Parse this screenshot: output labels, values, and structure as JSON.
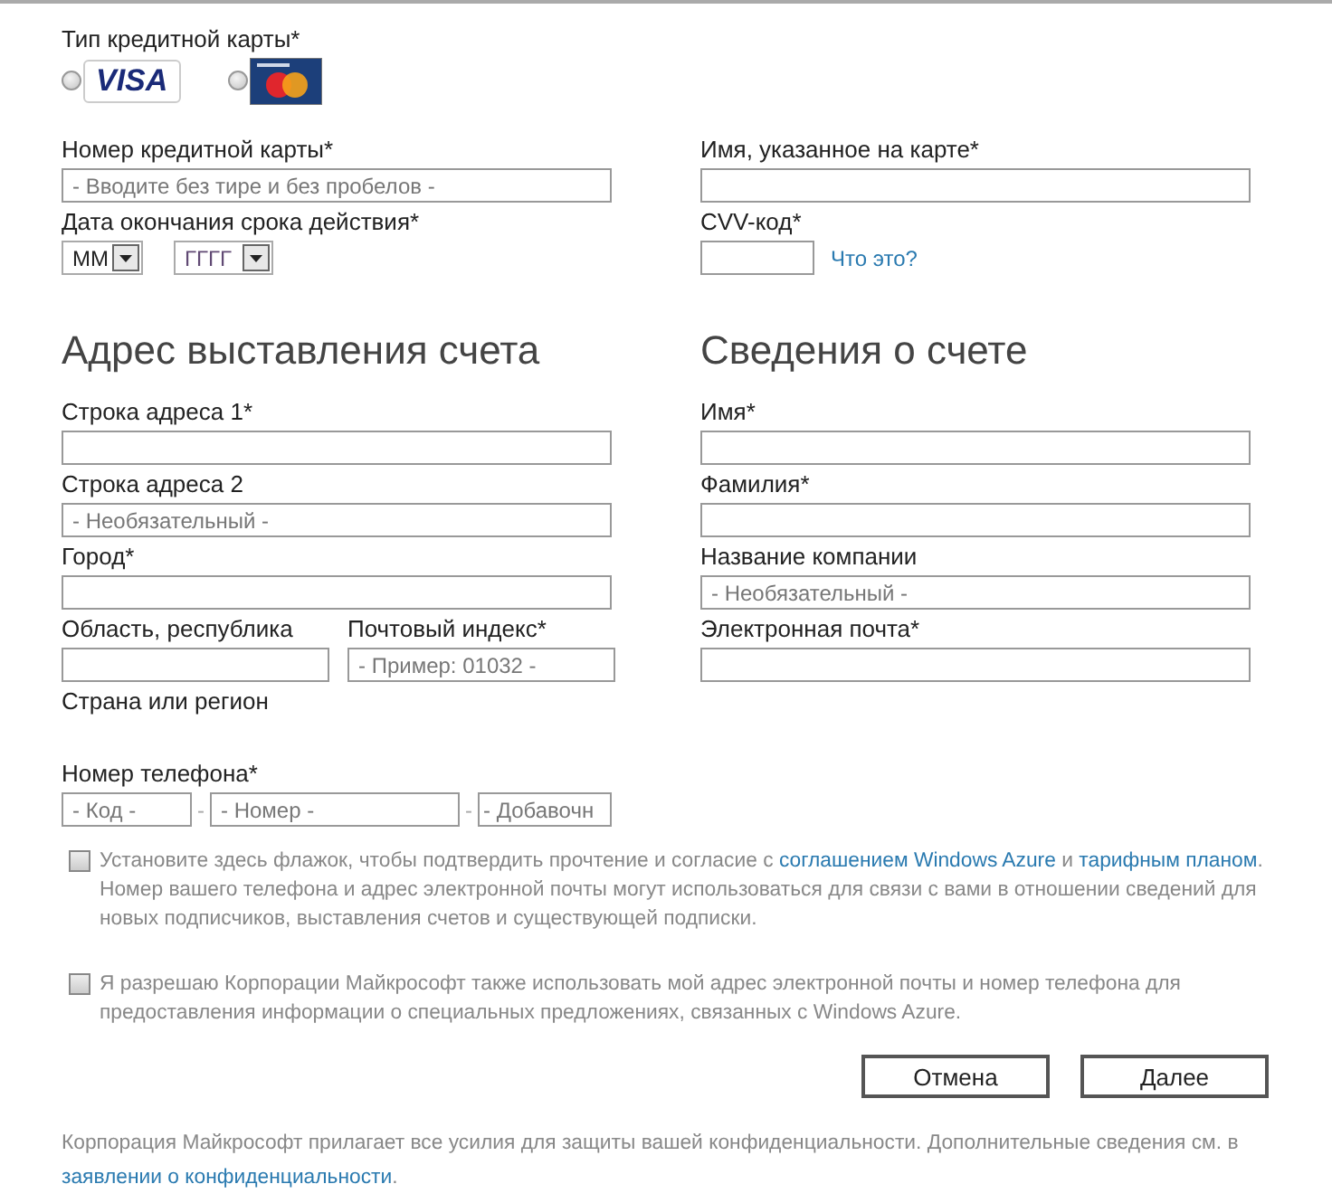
{
  "card_type": {
    "label": "Тип кредитной карты*",
    "options": [
      {
        "kind": "visa",
        "logo_text": "VISA",
        "selected": false
      },
      {
        "kind": "mastercard",
        "selected": false
      }
    ]
  },
  "card_number": {
    "label": "Номер кредитной карты*",
    "placeholder": "- Вводите без тире и без пробелов -"
  },
  "expiry": {
    "label": "Дата окончания срока действия*",
    "month": "ММ",
    "year": "ГГГГ"
  },
  "name_on_card": {
    "label": "Имя, указанное на карте*"
  },
  "cvv": {
    "label": "CVV-код*",
    "help_link": "Что это?"
  },
  "billing_address": {
    "title": "Адрес выставления счета",
    "fields": [
      {
        "label": "Строка адреса 1*"
      },
      {
        "label": "Строка адреса 2",
        "placeholder": "- Необязательный -"
      },
      {
        "label": "Город*"
      }
    ],
    "region": {
      "label": "Область, республика"
    },
    "postal_code": {
      "label": "Почтовый индекс*",
      "placeholder": "- Пример: 01032 -"
    },
    "country": {
      "label": "Страна или регион"
    },
    "phone": {
      "label": "Номер телефона*",
      "separator": "-",
      "parts": [
        {
          "placeholder": "- Код -"
        },
        {
          "placeholder": "- Номер -"
        },
        {
          "placeholder": "- Добавочн"
        }
      ]
    }
  },
  "account_info": {
    "title": "Сведения о счете",
    "fields": [
      {
        "label": "Имя*"
      },
      {
        "label": "Фамилия*"
      },
      {
        "label": "Название компании",
        "placeholder": "- Необязательный -"
      },
      {
        "label": "Электронная почта*"
      }
    ]
  },
  "consents": [
    {
      "checked": false,
      "segments": [
        {
          "text": "Установите здесь флажок, чтобы подтвердить прочтение и согласие с ",
          "link": false
        },
        {
          "text": "соглашением Windows Azure",
          "link": true
        },
        {
          "text": " и ",
          "link": false
        },
        {
          "text": "тарифным планом",
          "link": true
        },
        {
          "text": ". Номер вашего телефона и адрес электронной почты могут использоваться для связи с вами в отношении сведений для новых подписчиков, выставления счетов и существующей подписки.",
          "link": false
        }
      ]
    },
    {
      "checked": false,
      "segments": [
        {
          "text": "Я разрешаю Корпорации Майкрософт также использовать мой адрес электронной почты и номер телефона для предоставления информации о специальных предложениях, связанных с Windows Azure.",
          "link": false
        }
      ]
    }
  ],
  "buttons": [
    "Отмена",
    "Далее"
  ],
  "privacy": {
    "segments": [
      {
        "text": "Корпорация Майкрософт прилагает все усилия для защиты вашей конфиденциальности. Дополнительные сведения см. в ",
        "link": false
      },
      {
        "text": "заявлении о конфиденциальности",
        "link": true
      },
      {
        "text": ".",
        "link": false
      }
    ]
  }
}
